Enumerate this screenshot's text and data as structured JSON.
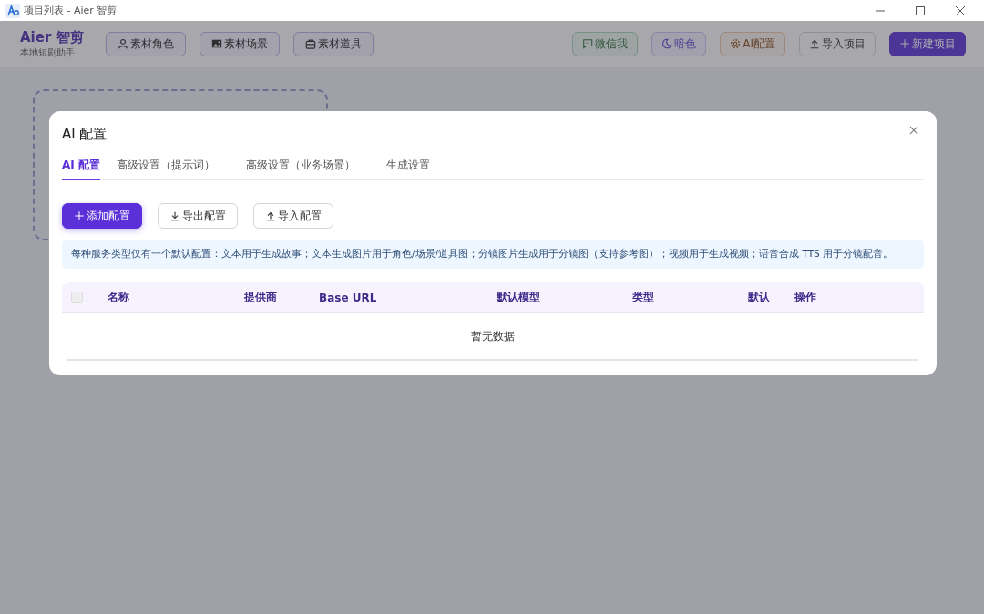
{
  "window": {
    "title": "项目列表 - Aier 智剪"
  },
  "header": {
    "app_name": "Aier 智剪",
    "subtitle": "本地短剧助手",
    "nav_buttons": [
      {
        "label": "素材角色"
      },
      {
        "label": "素材场景"
      },
      {
        "label": "素材道具"
      }
    ],
    "action_buttons": [
      {
        "label": "微信我",
        "kind": "green"
      },
      {
        "label": "暗色",
        "kind": "purple"
      },
      {
        "label": "AI配置",
        "kind": "orange"
      },
      {
        "label": "导入项目",
        "kind": "plain"
      },
      {
        "label": "新建项目",
        "kind": "primary"
      }
    ]
  },
  "dialog": {
    "title": "AI 配置",
    "tabs": [
      {
        "label": "AI 配置",
        "selected": true
      },
      {
        "label": "高级设置（提示词）",
        "selected": false
      },
      {
        "label": "高级设置（业务场景）",
        "selected": false
      },
      {
        "label": "生成设置",
        "selected": false
      }
    ],
    "buttons": [
      {
        "label": "添加配置",
        "kind": "primary"
      },
      {
        "label": "导出配置",
        "kind": "plain"
      },
      {
        "label": "导入配置",
        "kind": "plain"
      }
    ],
    "notice": "每种服务类型仅有一个默认配置：文本用于生成故事；文本生成图片用于角色/场景/道具图；分镜图片生成用于分镜图（支持参考图）；视频用于生成视频；语音合成 TTS 用于分镜配音。",
    "table": {
      "select_all_checked": false,
      "columns": [
        "名称",
        "提供商",
        "Base URL",
        "默认模型",
        "类型",
        "默认",
        "操作"
      ],
      "empty_text": "暂无数据"
    }
  }
}
